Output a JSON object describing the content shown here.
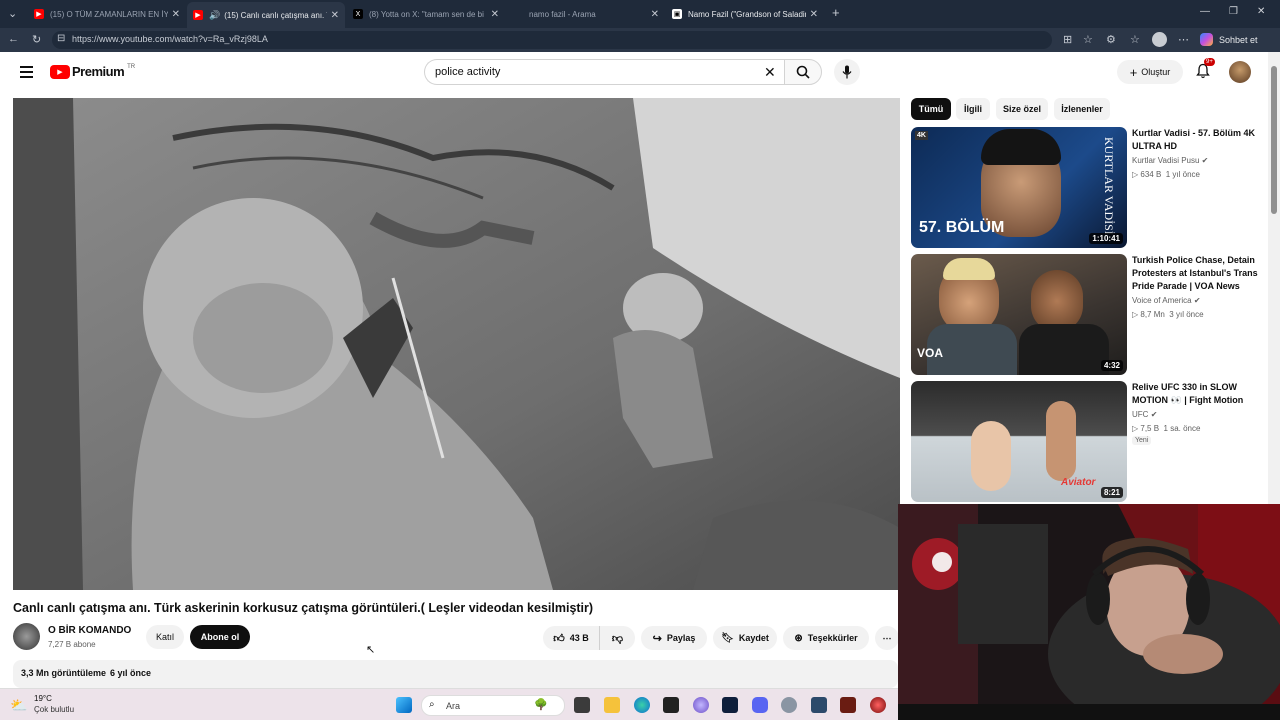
{
  "browser": {
    "tabs": [
      {
        "title": "(15) O TÜM ZAMANLARIN EN İYİSİ",
        "active": false
      },
      {
        "title": "(15) Canlı canlı çatışma anı. Tü",
        "active": true
      },
      {
        "title": "(8) Yotta on X: \"tamam sen de bi",
        "active": false
      },
      {
        "title": "namo fazil - Arama",
        "active": false
      },
      {
        "title": "Namo Fazil (\"Grandson of Saladin\"",
        "active": false
      }
    ],
    "url": "https://www.youtube.com/watch?v=Ra_vRzj98LA",
    "chat_label": "Sohbet et"
  },
  "youtube": {
    "logo_text": "Premium",
    "logo_region": "TR",
    "search_value": "police activity",
    "create_label": "Oluştur",
    "notif_count": "9+"
  },
  "video": {
    "title": "Canlı canlı çatışma anı. Türk askerinin korkusuz çatışma görüntüleri.( Leşler videodan kesilmiştir)",
    "channel": "O BİR KOMANDO",
    "subscribers": "7,27 B abone",
    "join_label": "Katıl",
    "subscribe_label": "Abone ol",
    "likes": "43 B",
    "share_label": "Paylaş",
    "save_label": "Kaydet",
    "thanks_label": "Teşekkürler",
    "views": "3,3 Mn görüntüleme",
    "age": "6 yıl önce"
  },
  "sidebar": {
    "chips": [
      "Tümü",
      "İlgili",
      "Size özel",
      "İzlenenler"
    ],
    "items": [
      {
        "title": "Kurtlar Vadisi - 57. Bölüm 4K ULTRA HD",
        "channel": "Kurtlar Vadisi Pusu",
        "views": "634 B",
        "age": "1 yıl önce",
        "duration": "1:10:41",
        "overlay": "57. BÖLÜM",
        "badge": ""
      },
      {
        "title": "Turkish Police Chase, Detain Protesters at Istanbul's Trans Pride Parade | VOA News",
        "channel": "Voice of America",
        "views": "8,7 Mn",
        "age": "3 yıl önce",
        "duration": "4:32",
        "overlay": "VOA",
        "badge": ""
      },
      {
        "title": "Relive UFC 330 in SLOW MOTION 👀 | Fight Motion",
        "channel": "UFC",
        "views": "7,5 B",
        "age": "1 sa. önce",
        "duration": "8:21",
        "overlay": "",
        "badge": "Yeni"
      }
    ]
  },
  "taskbar": {
    "temperature": "19°C",
    "weather": "Çok bulutlu",
    "search_placeholder": "Ara"
  },
  "colors": {
    "youtube_red": "#ff0000",
    "chrome_dark": "#1f2a3a",
    "subscribe_bg": "#0f0f0f"
  }
}
